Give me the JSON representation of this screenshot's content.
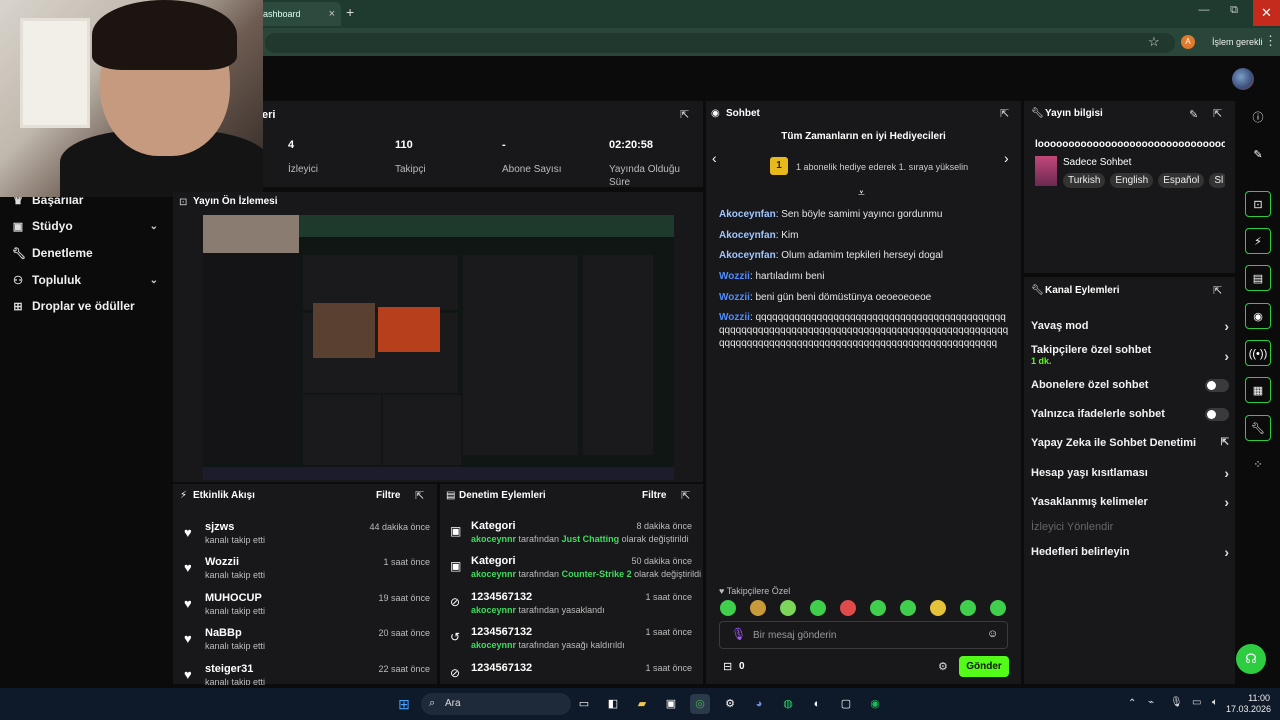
{
  "browser": {
    "tab_label": "ashboard",
    "tab_close": "×",
    "new_tab": "+",
    "profile_letter": "A",
    "action_text": "İşlem gerekli",
    "minimize": "—",
    "maximize": "⧉",
    "close": "✕"
  },
  "sidebar": {
    "items": [
      {
        "label": "Başarılar",
        "icon": "trophy-icon"
      },
      {
        "label": "Stüdyo",
        "icon": "video-icon",
        "chevron": true
      },
      {
        "label": "Denetleme",
        "icon": "wrench-icon"
      },
      {
        "label": "Topluluk",
        "icon": "people-icon",
        "chevron": true
      },
      {
        "label": "Droplar ve ödüller",
        "icon": "gift-icon"
      }
    ]
  },
  "stats": {
    "title_fragment": "eri",
    "items": [
      {
        "value": "4",
        "label": "İzleyici"
      },
      {
        "value": "110",
        "label": "Takipçi"
      },
      {
        "value": "-",
        "label": "Abone Sayısı"
      },
      {
        "value": "02:20:58",
        "label": "Yayında Olduğu Süre"
      }
    ]
  },
  "preview": {
    "title": "Yayın Ön İzlemesi"
  },
  "activity": {
    "title": "Etkinlik Akışı",
    "filter": "Filtre",
    "items": [
      {
        "name": "sjzws",
        "sub": "kanalı takip etti",
        "time": "44 dakika önce"
      },
      {
        "name": "Wozzii",
        "sub": "kanalı takip etti",
        "time": "1 saat önce"
      },
      {
        "name": "MUHOCUP",
        "sub": "kanalı takip etti",
        "time": "19 saat önce"
      },
      {
        "name": "NaBBp",
        "sub": "kanalı takip etti",
        "time": "20 saat önce"
      },
      {
        "name": "steiger31",
        "sub": "kanalı takip etti",
        "time": "22 saat önce"
      }
    ]
  },
  "moderation": {
    "title": "Denetim Eylemleri",
    "filter": "Filtre",
    "items": [
      {
        "name": "Kategori",
        "user": "akoceynnr",
        "mid": " tarafından ",
        "target": "Just Chatting",
        "end": " olarak değiştirildi",
        "time": "8 dakika önce",
        "icon": "category-icon"
      },
      {
        "name": "Kategori",
        "user": "akoceynnr",
        "mid": " tarafından ",
        "target": "Counter-Strike 2",
        "end": " olarak değiştirildi",
        "time": "50 dakika önce",
        "icon": "category-icon"
      },
      {
        "name": "1234567132",
        "user": "akoceynnr",
        "mid": " tarafından yasaklandı",
        "target": "",
        "end": "",
        "time": "1 saat önce",
        "icon": "ban-icon"
      },
      {
        "name": "1234567132",
        "user": "akoceynnr",
        "mid": " tarafından yasağı kaldırıldı",
        "target": "",
        "end": "",
        "time": "1 saat önce",
        "icon": "unban-icon"
      },
      {
        "name": "1234567132",
        "user": "",
        "mid": "",
        "target": "",
        "end": "",
        "time": "1 saat önce",
        "icon": "ban-icon"
      }
    ]
  },
  "chat": {
    "title": "Sohbet",
    "gifters_title": "Tüm Zamanların en iyi Hediyecileri",
    "rank": "1",
    "gifters_sub": "1 abonelik hediye ederek 1. sıraya yükselin",
    "messages": [
      {
        "user": "Akoceynfan",
        "text": " Sen böyle samimi yayıncı gordunmu",
        "color": "#9fc7ff"
      },
      {
        "user": "Akoceynfan",
        "text": " Kim",
        "color": "#9fc7ff"
      },
      {
        "user": "Akoceynfan",
        "text": " Olum adamim tepkileri herseyi dogal",
        "color": "#9fc7ff"
      },
      {
        "user": "Wozzii",
        "text": " hartıladımı beni",
        "color": "#4f8cff"
      },
      {
        "user": "Wozzii",
        "text": " beni gün beni dömüstünya oeoeoeoeoe",
        "color": "#4f8cff"
      },
      {
        "user": "Wozzii",
        "text": " qqqqqqqqqqqqqqqqqqqqqqqqqqqqqqqqqqqqqqqqqqqqqqqqqqqqqqqqqqqqqqqqqqqqqqqqqqqqqqqqqqqqqqqqqqqqqqqqqqqqqqqqqqqqqqqqqqqqqqqqqqqqqqqqqqqqqqqqqqqqqqqqqqq",
        "color": "#4f8cff"
      }
    ],
    "followers_only": "Takipçilere Özel",
    "input_placeholder": "Bir mesaj gönderin",
    "points": "0",
    "send": "Gönder"
  },
  "stream_info": {
    "title": "Yayın bilgisi",
    "stream_title": "looooooooooooooooooooooooooooooooooooooooooooll",
    "category": "Sadece Sohbet",
    "tags": [
      "Turkish",
      "English",
      "Español",
      "Sl"
    ]
  },
  "channel_actions": {
    "title": "Kanal Eylemleri",
    "items": [
      {
        "label": "Yavaş mod",
        "kind": "arrow"
      },
      {
        "label": "Takipçilere özel sohbet",
        "sub": "1 dk.",
        "kind": "arrow"
      },
      {
        "label": "Abonelere özel sohbet",
        "kind": "toggle"
      },
      {
        "label": "Yalnızca ifadelerle sohbet",
        "kind": "toggle"
      },
      {
        "label": "Yapay Zeka ile Sohbet Denetimi",
        "kind": "external"
      },
      {
        "label": "Hesap yaşı kısıtlaması",
        "kind": "arrow"
      },
      {
        "label": "Yasaklanmış kelimeler",
        "kind": "arrow"
      },
      {
        "label": "İzleyici Yönlendir",
        "kind": "disabled"
      },
      {
        "label": "Hedefleri belirleyin",
        "kind": "arrow"
      }
    ]
  },
  "taskbar": {
    "search": "Ara",
    "time": "11:00",
    "date": "17.03.2026"
  },
  "colors": {
    "accent": "#53fc18",
    "panel": "#18181b",
    "bg": "#0b0b0c",
    "taskbar": "#0e1a2a",
    "close": "#c42b1c"
  }
}
